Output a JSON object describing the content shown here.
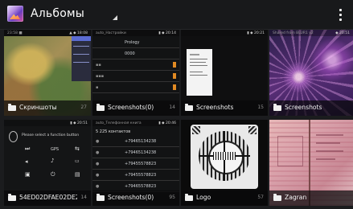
{
  "header": {
    "title": "Альбомы"
  },
  "albums": [
    {
      "name": "Скриншоты",
      "count": "27"
    },
    {
      "name": "Screenshots(0)",
      "count": "14"
    },
    {
      "name": "Screenshots",
      "count": "15"
    },
    {
      "name": "Screenshots",
      "count": ""
    },
    {
      "name": "54ED02DFAE02DE2CA",
      "count": "14"
    },
    {
      "name": "Screenshots(0)",
      "count": "95"
    },
    {
      "name": "Logo",
      "count": "57"
    },
    {
      "name": "Zagran",
      "count": ""
    }
  ],
  "thumbs": {
    "settings_rows": [
      "Prology",
      "0000"
    ],
    "contacts_header": "5 225 контактов",
    "contacts": [
      "+79465134238",
      "+79465134238",
      "+79455578823",
      "+79455578823",
      "+79465578823"
    ],
    "remote_hint": "Please select a function button",
    "remote_gps": "GPS"
  },
  "colors": {
    "background": "#1b1c1e",
    "caption": "#0a0a0c",
    "accent": "#e08a23"
  }
}
